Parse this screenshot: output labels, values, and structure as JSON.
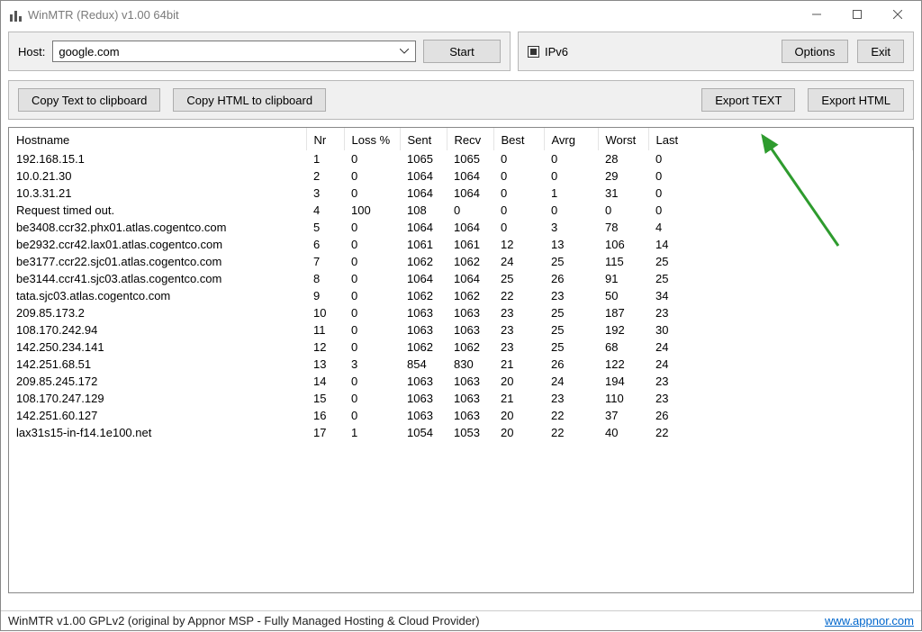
{
  "window": {
    "title": "WinMTR (Redux) v1.00 64bit"
  },
  "host_panel": {
    "label": "Host:",
    "value": "google.com",
    "start_button": "Start"
  },
  "opts_panel": {
    "ipv6_label": "IPv6",
    "options_button": "Options",
    "exit_button": "Exit"
  },
  "toolbar": {
    "copy_text": "Copy Text to clipboard",
    "copy_html": "Copy HTML to clipboard",
    "export_text": "Export TEXT",
    "export_html": "Export HTML"
  },
  "columns": {
    "hostname": "Hostname",
    "nr": "Nr",
    "loss": "Loss %",
    "sent": "Sent",
    "recv": "Recv",
    "best": "Best",
    "avrg": "Avrg",
    "worst": "Worst",
    "last": "Last"
  },
  "rows": [
    {
      "hostname": "192.168.15.1",
      "nr": 1,
      "loss": 0,
      "sent": 1065,
      "recv": 1065,
      "best": 0,
      "avrg": 0,
      "worst": 28,
      "last": 0
    },
    {
      "hostname": "10.0.21.30",
      "nr": 2,
      "loss": 0,
      "sent": 1064,
      "recv": 1064,
      "best": 0,
      "avrg": 0,
      "worst": 29,
      "last": 0
    },
    {
      "hostname": "10.3.31.21",
      "nr": 3,
      "loss": 0,
      "sent": 1064,
      "recv": 1064,
      "best": 0,
      "avrg": 1,
      "worst": 31,
      "last": 0
    },
    {
      "hostname": "Request timed out.",
      "nr": 4,
      "loss": 100,
      "sent": 108,
      "recv": 0,
      "best": 0,
      "avrg": 0,
      "worst": 0,
      "last": 0
    },
    {
      "hostname": "be3408.ccr32.phx01.atlas.cogentco.com",
      "nr": 5,
      "loss": 0,
      "sent": 1064,
      "recv": 1064,
      "best": 0,
      "avrg": 3,
      "worst": 78,
      "last": 4
    },
    {
      "hostname": "be2932.ccr42.lax01.atlas.cogentco.com",
      "nr": 6,
      "loss": 0,
      "sent": 1061,
      "recv": 1061,
      "best": 12,
      "avrg": 13,
      "worst": 106,
      "last": 14
    },
    {
      "hostname": "be3177.ccr22.sjc01.atlas.cogentco.com",
      "nr": 7,
      "loss": 0,
      "sent": 1062,
      "recv": 1062,
      "best": 24,
      "avrg": 25,
      "worst": 115,
      "last": 25
    },
    {
      "hostname": "be3144.ccr41.sjc03.atlas.cogentco.com",
      "nr": 8,
      "loss": 0,
      "sent": 1064,
      "recv": 1064,
      "best": 25,
      "avrg": 26,
      "worst": 91,
      "last": 25
    },
    {
      "hostname": "tata.sjc03.atlas.cogentco.com",
      "nr": 9,
      "loss": 0,
      "sent": 1062,
      "recv": 1062,
      "best": 22,
      "avrg": 23,
      "worst": 50,
      "last": 34
    },
    {
      "hostname": "209.85.173.2",
      "nr": 10,
      "loss": 0,
      "sent": 1063,
      "recv": 1063,
      "best": 23,
      "avrg": 25,
      "worst": 187,
      "last": 23
    },
    {
      "hostname": "108.170.242.94",
      "nr": 11,
      "loss": 0,
      "sent": 1063,
      "recv": 1063,
      "best": 23,
      "avrg": 25,
      "worst": 192,
      "last": 30
    },
    {
      "hostname": "142.250.234.141",
      "nr": 12,
      "loss": 0,
      "sent": 1062,
      "recv": 1062,
      "best": 23,
      "avrg": 25,
      "worst": 68,
      "last": 24
    },
    {
      "hostname": "142.251.68.51",
      "nr": 13,
      "loss": 3,
      "sent": 854,
      "recv": 830,
      "best": 21,
      "avrg": 26,
      "worst": 122,
      "last": 24
    },
    {
      "hostname": "209.85.245.172",
      "nr": 14,
      "loss": 0,
      "sent": 1063,
      "recv": 1063,
      "best": 20,
      "avrg": 24,
      "worst": 194,
      "last": 23
    },
    {
      "hostname": "108.170.247.129",
      "nr": 15,
      "loss": 0,
      "sent": 1063,
      "recv": 1063,
      "best": 21,
      "avrg": 23,
      "worst": 110,
      "last": 23
    },
    {
      "hostname": "142.251.60.127",
      "nr": 16,
      "loss": 0,
      "sent": 1063,
      "recv": 1063,
      "best": 20,
      "avrg": 22,
      "worst": 37,
      "last": 26
    },
    {
      "hostname": "lax31s15-in-f14.1e100.net",
      "nr": 17,
      "loss": 1,
      "sent": 1054,
      "recv": 1053,
      "best": 20,
      "avrg": 22,
      "worst": 40,
      "last": 22
    }
  ],
  "status": {
    "text": "WinMTR v1.00 GPLv2 (original by Appnor MSP - Fully Managed Hosting & Cloud Provider)",
    "link": "www.appnor.com"
  },
  "annotation": {
    "arrow_color": "#2e9b2e"
  }
}
